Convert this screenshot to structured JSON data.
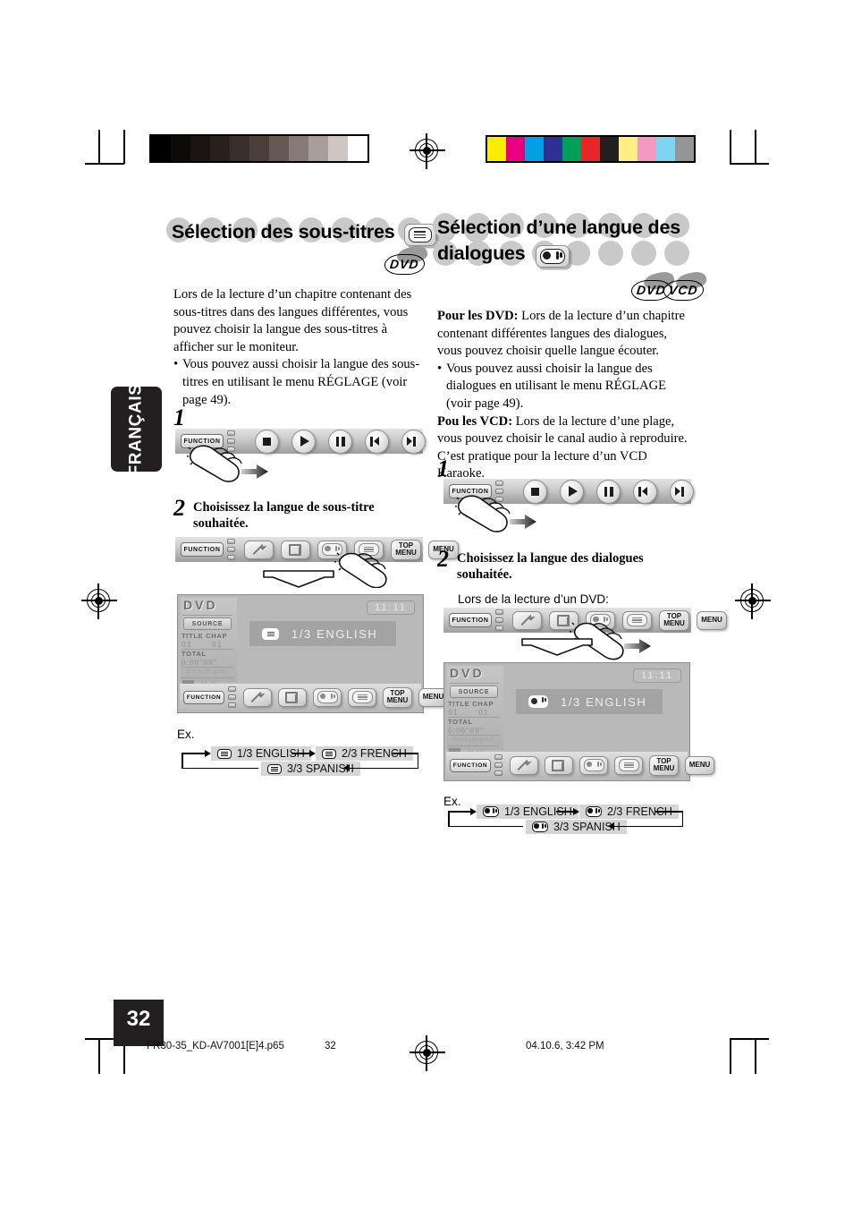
{
  "page": {
    "number": "32",
    "language_tab": "FRANÇAIS"
  },
  "color_bars": {
    "grayscale": [
      "#000000",
      "#0d0a0a",
      "#1a1513",
      "#27201c",
      "#3a302a",
      "#4a3f39",
      "#655953",
      "#867b76",
      "#a89e99",
      "#cfc6c1",
      "#ffffff"
    ],
    "color": [
      "#fced00",
      "#e6007e",
      "#00a0e3",
      "#2e3192",
      "#00a05a",
      "#e8252a",
      "#231f20",
      "#fbef86",
      "#f49ac1",
      "#7fd4f4",
      "#939598"
    ]
  },
  "left_column": {
    "heading": "Sélection des sous-titres",
    "heading_button_icon": "subtitle-icon",
    "disc_logos": [
      "DVD"
    ],
    "intro": [
      "Lors de la lecture d’un chapitre contenant des",
      "sous-titres dans des langues différentes, vous",
      "pouvez choisir la langue des sous-titres à",
      "afficher sur le moniteur."
    ],
    "bullets": [
      "Vous pouvez aussi choisir la langue des sous-titres en utilisant le menu RÉGLAGE (voir page 49)."
    ],
    "steps": [
      {
        "number": "1",
        "text": ""
      },
      {
        "number": "2",
        "text": "Choisissez la langue de sous-titre souhaitée."
      }
    ],
    "control_bar_1": {
      "function_label": "FUNCTION",
      "buttons": [
        "stop-icon",
        "play-icon",
        "pause-icon",
        "previous-icon",
        "next-icon"
      ]
    },
    "control_bar_2": {
      "function_label": "FUNCTION",
      "buttons": [
        "zoom-arrow-icon",
        "angle-icon",
        "audio-icon",
        "subtitle-icon"
      ],
      "top_menu_label_line1": "TOP",
      "top_menu_label_line2": "MENU",
      "menu_label": "MENU"
    },
    "screen": {
      "source_name": "DVD",
      "source_button": "SOURCE",
      "title_chap_label": "TITLE  CHAP",
      "title_value": "01",
      "chap_value": "01",
      "total_label": "TOTAL",
      "total_value": "0:00\"09\"",
      "dolby_label": "DolbyDigital",
      "eq_label": "FLAT",
      "digital_label": "Digital",
      "clock": "11:11",
      "osd_text": "1/3  ENGLISH",
      "osd_icon": "subtitle-icon"
    },
    "example": {
      "label": "Ex.",
      "items": [
        {
          "icon": "subtitle-icon",
          "text": "1/3 ENGLISH"
        },
        {
          "icon": "subtitle-icon",
          "text": "2/3 FRENCH"
        },
        {
          "icon": "subtitle-icon",
          "text": "3/3 SPANISH"
        }
      ]
    }
  },
  "right_column": {
    "heading_line1": "Sélection d’une langue des",
    "heading_line2": "dialogues",
    "heading_button_icon": "audio-icon",
    "disc_logos": [
      "DVD",
      "VCD"
    ],
    "paragraphs": [
      {
        "lead": "Pour les DVD:",
        "rest": " Lors de la lecture d’un chapitre"
      },
      {
        "lead": "",
        "rest": "contenant différentes langues des dialogues,"
      },
      {
        "lead": "",
        "rest": "vous pouvez choisir quelle langue écouter."
      }
    ],
    "bullets": [
      "Vous pouvez aussi choisir la langue des dialogues en utilisant le menu RÉGLAGE (voir page 49)."
    ],
    "paragraphs2": [
      {
        "lead": "Pou les VCD:",
        "rest": " Lors de la lecture d’une plage,"
      },
      {
        "lead": "",
        "rest": "vous pouvez choisir le canal audio à reproduire."
      },
      {
        "lead": "",
        "rest": "C’est pratique pour la lecture d’un VCD Karaoke."
      }
    ],
    "steps": [
      {
        "number": "1",
        "text": ""
      },
      {
        "number": "2",
        "text": "Choisissez la langue des dialogues souhaitée."
      }
    ],
    "note": "Lors de la lecture d’un DVD:",
    "control_bar_1": {
      "function_label": "FUNCTION",
      "buttons": [
        "stop-icon",
        "play-icon",
        "pause-icon",
        "previous-icon",
        "next-icon"
      ]
    },
    "control_bar_2": {
      "function_label": "FUNCTION",
      "buttons": [
        "zoom-arrow-icon",
        "angle-icon",
        "audio-icon",
        "subtitle-icon"
      ],
      "top_menu_label_line1": "TOP",
      "top_menu_label_line2": "MENU",
      "menu_label": "MENU"
    },
    "screen": {
      "source_name": "DVD",
      "source_button": "SOURCE",
      "title_chap_label": "TITLE  CHAP",
      "title_value": "01",
      "chap_value": "01",
      "total_label": "TOTAL",
      "total_value": "0:00\"09\"",
      "dolby_label": "DolbyDigital",
      "eq_label": "FLAT",
      "digital_label": "Digital",
      "clock": "11:11",
      "osd_text": "1/3  ENGLISH",
      "osd_icon": "audio-icon"
    },
    "example": {
      "label": "Ex.",
      "items": [
        {
          "icon": "audio-icon",
          "text": "1/3 ENGLISH"
        },
        {
          "icon": "audio-icon",
          "text": "2/3 FRENCH"
        },
        {
          "icon": "audio-icon",
          "text": "3/3 SPANISH"
        }
      ]
    }
  },
  "footer": {
    "filename": "FR30-35_KD-AV7001[E]4.p65",
    "page": "32",
    "timestamp": "04.10.6, 3:42 PM"
  }
}
